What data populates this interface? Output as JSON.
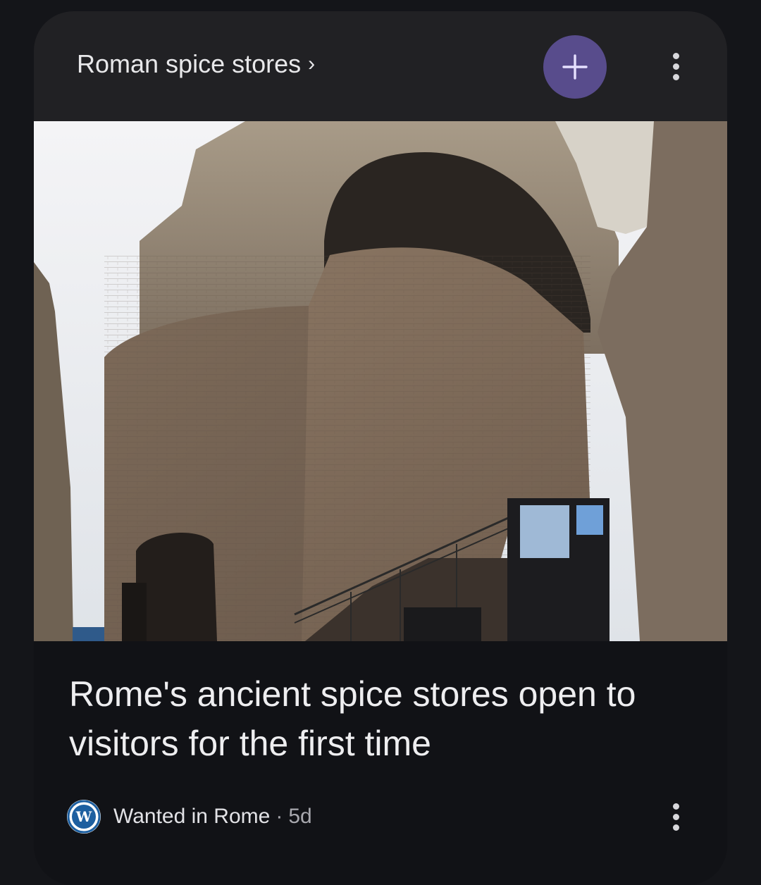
{
  "card": {
    "topic": "Roman spice stores",
    "topic_chevron": "›",
    "follow_icon": "plus-icon",
    "menu_icon": "more-vert-icon"
  },
  "article": {
    "headline": "Rome's ancient spice stores open to visitors for the first time",
    "image_icon": "article-photo",
    "source": {
      "logo_icon": "wanted-in-rome-logo",
      "logo_letter": "W",
      "name": "Wanted in Rome",
      "separator": "·",
      "age": "5d"
    },
    "menu_icon": "more-vert-icon"
  },
  "colors": {
    "background": "#141519",
    "card": "#111216",
    "header": "#212124",
    "accent": "#584c8c"
  }
}
